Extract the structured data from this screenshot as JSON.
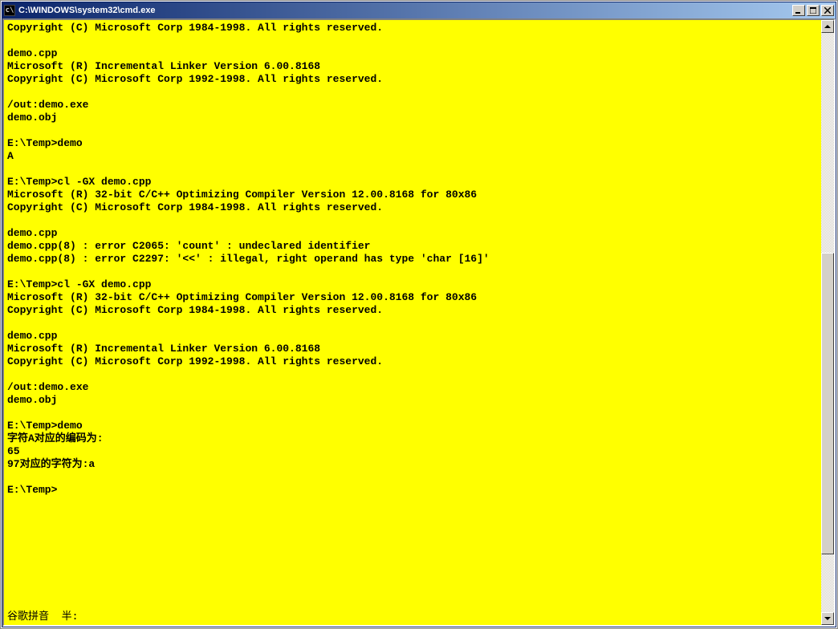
{
  "window": {
    "title": "C:\\WINDOWS\\system32\\cmd.exe",
    "sysicon_label": "cmd-icon"
  },
  "colors": {
    "console_bg": "#ffff00",
    "console_fg": "#000000",
    "titlebar_start": "#0a246a",
    "titlebar_end": "#a6caf0"
  },
  "console_lines": [
    "Copyright (C) Microsoft Corp 1984-1998. All rights reserved.",
    "",
    "demo.cpp",
    "Microsoft (R) Incremental Linker Version 6.00.8168",
    "Copyright (C) Microsoft Corp 1992-1998. All rights reserved.",
    "",
    "/out:demo.exe",
    "demo.obj",
    "",
    "E:\\Temp>demo",
    "A",
    "",
    "E:\\Temp>cl -GX demo.cpp",
    "Microsoft (R) 32-bit C/C++ Optimizing Compiler Version 12.00.8168 for 80x86",
    "Copyright (C) Microsoft Corp 1984-1998. All rights reserved.",
    "",
    "demo.cpp",
    "demo.cpp(8) : error C2065: 'count' : undeclared identifier",
    "demo.cpp(8) : error C2297: '<<' : illegal, right operand has type 'char [16]'",
    "",
    "E:\\Temp>cl -GX demo.cpp",
    "Microsoft (R) 32-bit C/C++ Optimizing Compiler Version 12.00.8168 for 80x86",
    "Copyright (C) Microsoft Corp 1984-1998. All rights reserved.",
    "",
    "demo.cpp",
    "Microsoft (R) Incremental Linker Version 6.00.8168",
    "Copyright (C) Microsoft Corp 1992-1998. All rights reserved.",
    "",
    "/out:demo.exe",
    "demo.obj",
    "",
    "E:\\Temp>demo",
    "字符A对应的编码为:",
    "65",
    "97对应的字符为:a",
    "",
    "E:\\Temp>"
  ],
  "ime_status": "谷歌拼音  半:"
}
